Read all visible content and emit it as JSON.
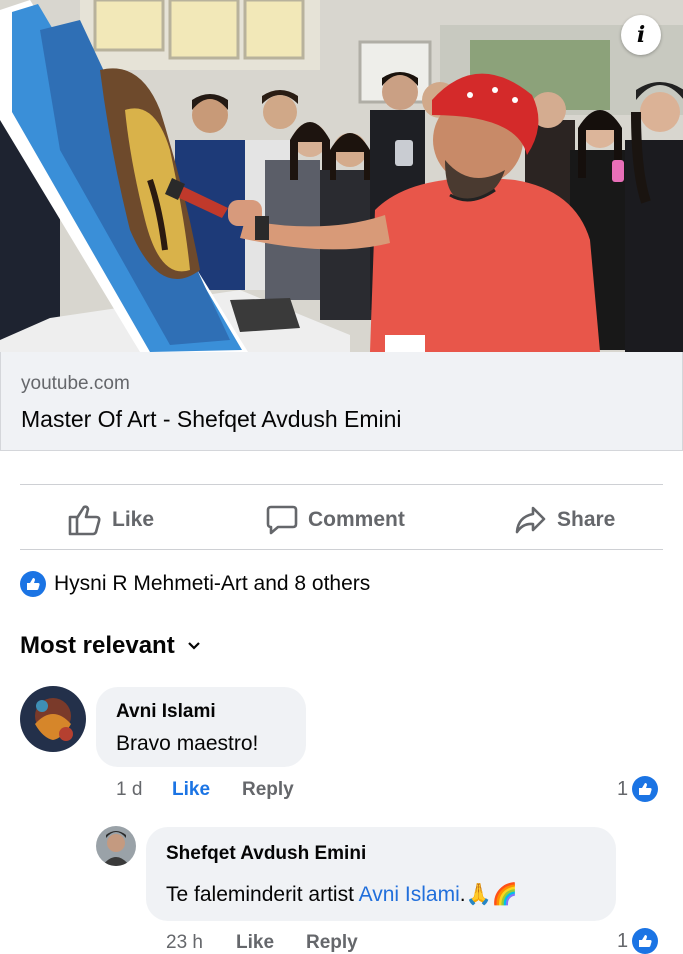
{
  "link_preview": {
    "domain": "youtube.com",
    "title": "Master Of Art - Shefqet Avdush Emini"
  },
  "info_icon": "i",
  "actions": {
    "like": "Like",
    "comment": "Comment",
    "share": "Share"
  },
  "reactions": {
    "text": "Hysni R Mehmeti-Art and 8 others"
  },
  "sort": {
    "label": "Most relevant"
  },
  "comments": [
    {
      "author": "Avni Islami",
      "text": "Bravo maestro!",
      "time": "1 d",
      "like_label": "Like",
      "reply_label": "Reply",
      "reaction_count": "1"
    },
    {
      "author": "Shefqet Avdush Emini",
      "text_before": "Te faleminderit artist ",
      "mention": "Avni Islami",
      "text_after": ".🙏🌈",
      "time": "23 h",
      "like_label": "Like",
      "reply_label": "Reply",
      "reaction_count": "1"
    }
  ],
  "colors": {
    "accent": "#1b74e4",
    "mention": "#216fdb",
    "secondary_text": "#65676b",
    "bubble_bg": "#f0f2f5",
    "shirt": "#e8564a",
    "bandana": "#d42a2a"
  }
}
